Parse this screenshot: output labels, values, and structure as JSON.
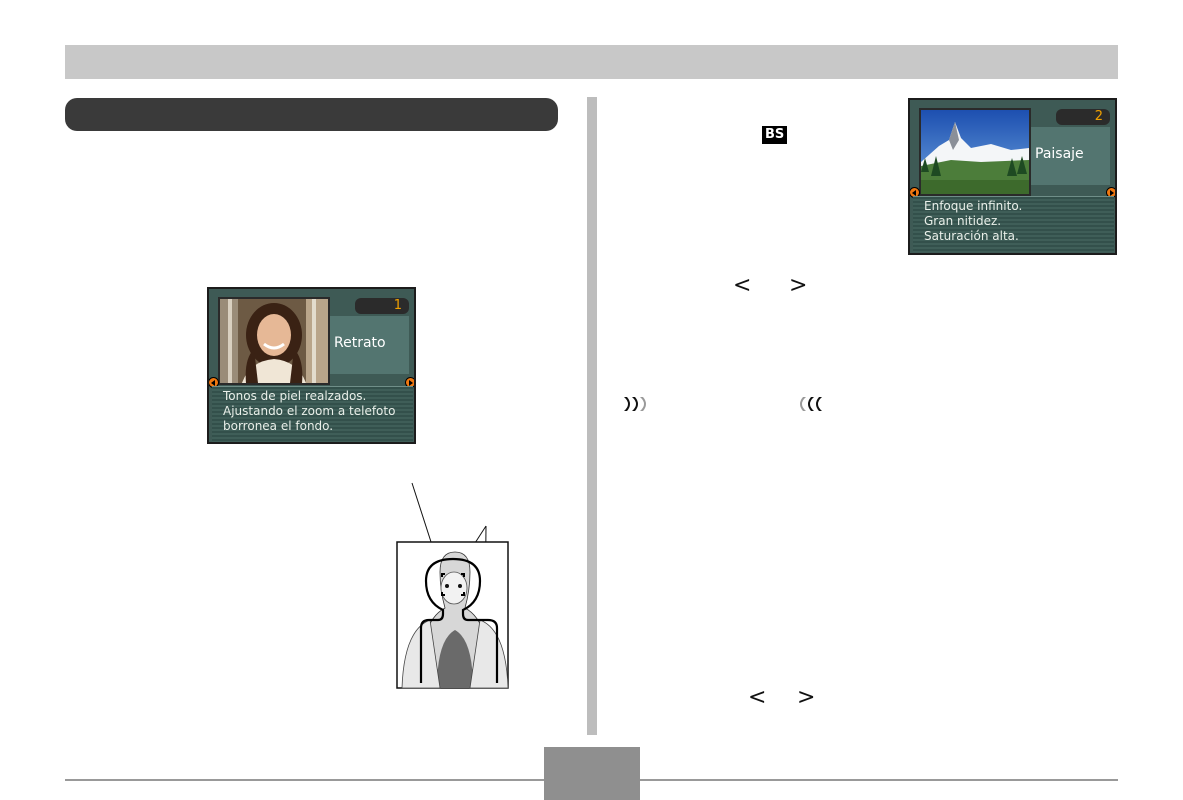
{
  "screens": {
    "portrait": {
      "number": "1",
      "scene_name": "Retrato",
      "description_lines": [
        "Tonos de piel realzados.",
        "Ajustando el zoom a telefoto",
        "borronea el fondo."
      ]
    },
    "landscape": {
      "number": "2",
      "scene_name": "Paisaje",
      "description_lines": [
        "Enfoque infinito.",
        "Gran nitidez.",
        "Saturación alta."
      ]
    }
  },
  "right_column": {
    "bs_icon_label": "BS",
    "nav_row_1": {
      "left": "<",
      "right": ">"
    },
    "nav_row_2": {
      "left": "<",
      "right": ">"
    }
  },
  "icons": [
    "bs-mode-icon",
    "important-start-icon",
    "important-end-icon",
    "left-arrow-icon",
    "right-arrow-icon"
  ],
  "colors": {
    "screen_bg": "#3e5a55",
    "scene_number": "#f0a000",
    "nav_arrow": "#f07810"
  }
}
